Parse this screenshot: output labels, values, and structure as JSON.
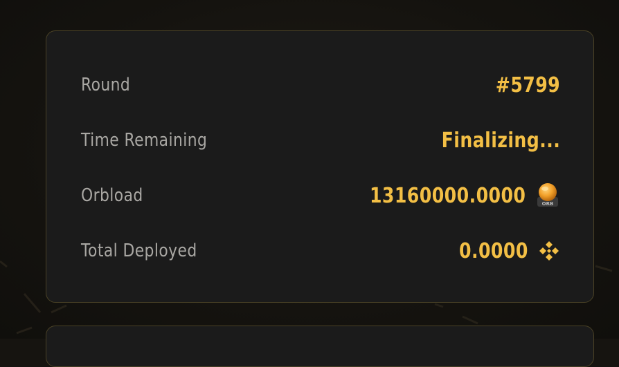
{
  "stats": {
    "rows": [
      {
        "label": "Round",
        "value": "#5799"
      },
      {
        "label": "Time Remaining",
        "value": "Finalizing..."
      },
      {
        "label": "Orbload",
        "value": "13160000.0000",
        "icon": "orb-token-icon",
        "icon_text": "ORB"
      },
      {
        "label": "Total Deployed",
        "value": "0.0000",
        "icon": "bnb-icon"
      }
    ]
  },
  "colors": {
    "accent": "#f3bf45",
    "label": "#a9a7a3",
    "card_bg": "#1b1b1b",
    "card_border": "#4a4226",
    "page_bg": "#161410"
  }
}
